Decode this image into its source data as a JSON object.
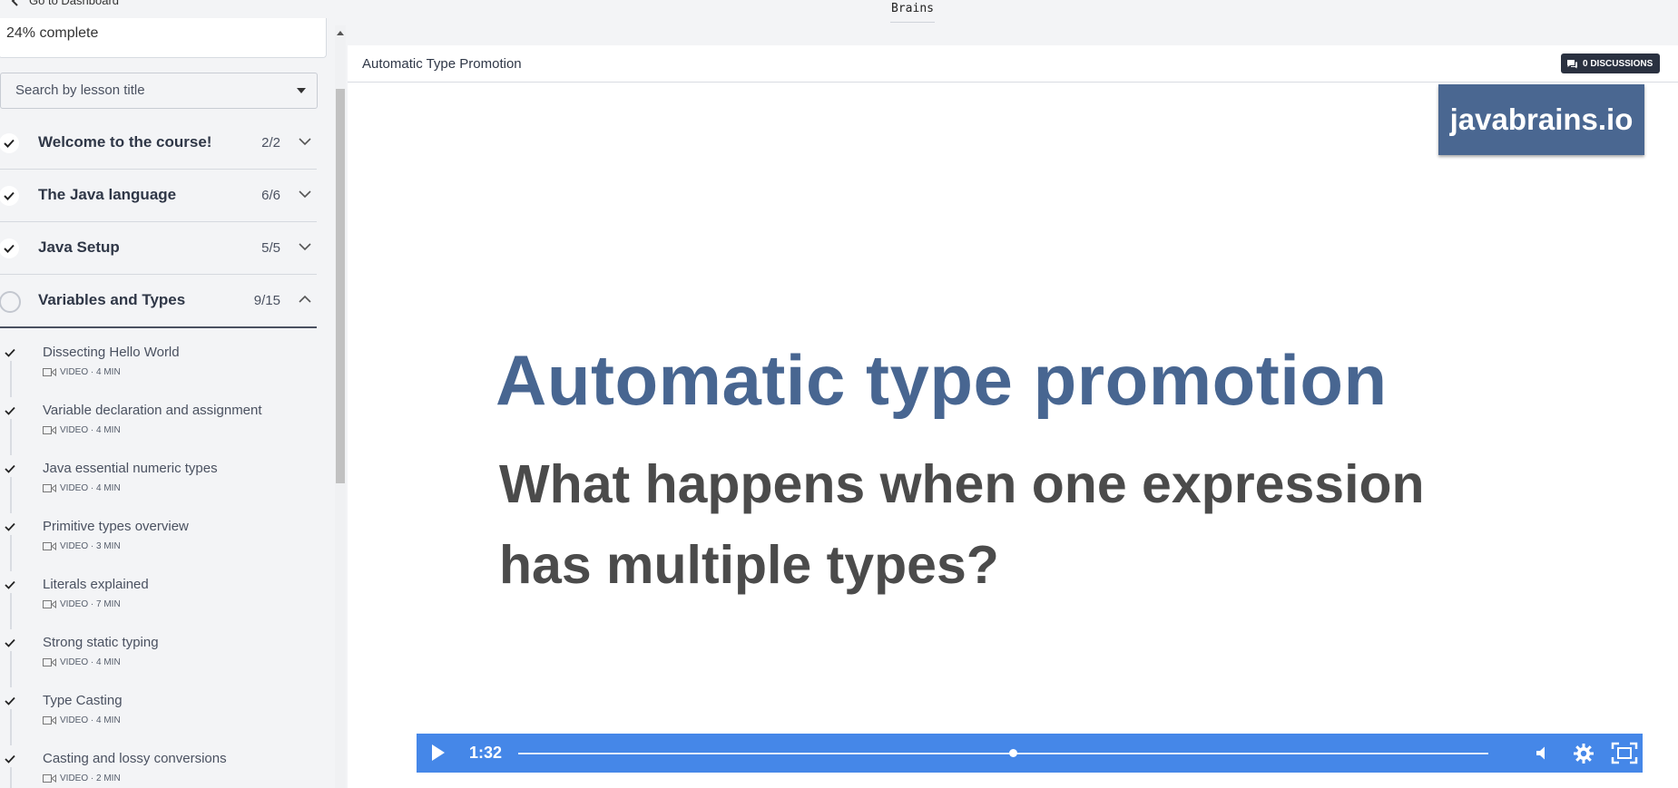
{
  "topbar": {
    "back_label": "Go to Dashboard",
    "logo_text": "Brains"
  },
  "sidebar": {
    "progress_text": "24% complete",
    "search_placeholder": "Search by lesson title",
    "sections": [
      {
        "title": "Welcome to the course!",
        "count": "2/2",
        "state": "complete"
      },
      {
        "title": "The Java language",
        "count": "6/6",
        "state": "complete"
      },
      {
        "title": "Java Setup",
        "count": "5/5",
        "state": "complete"
      },
      {
        "title": "Variables and Types",
        "count": "9/15",
        "state": "in-progress"
      }
    ],
    "lessons": [
      {
        "title": "Dissecting Hello World",
        "meta": "VIDEO · 4 MIN"
      },
      {
        "title": "Variable declaration and assignment",
        "meta": "VIDEO · 4 MIN"
      },
      {
        "title": "Java essential numeric types",
        "meta": "VIDEO · 4 MIN"
      },
      {
        "title": "Primitive types overview",
        "meta": "VIDEO · 3 MIN"
      },
      {
        "title": "Literals explained",
        "meta": "VIDEO · 7 MIN"
      },
      {
        "title": "Strong static typing",
        "meta": "VIDEO · 4 MIN"
      },
      {
        "title": "Type Casting",
        "meta": "VIDEO · 4 MIN"
      },
      {
        "title": "Casting and lossy conversions",
        "meta": "VIDEO · 2 MIN"
      }
    ]
  },
  "main": {
    "lesson_title": "Automatic Type Promotion",
    "discussions_label": "0 DISCUSSIONS",
    "video": {
      "watermark": "javabrains.io",
      "slide_title": "Automatic type promotion",
      "slide_subtitle_line1": "What happens when one expression",
      "slide_subtitle_line2": "has multiple types?",
      "current_time": "1:32",
      "progress_fraction": 0.51
    }
  },
  "colors": {
    "accent": "#4587e8",
    "slide_title": "#486691",
    "watermark_bg": "#4a6791",
    "dark_button": "#2a3140"
  }
}
